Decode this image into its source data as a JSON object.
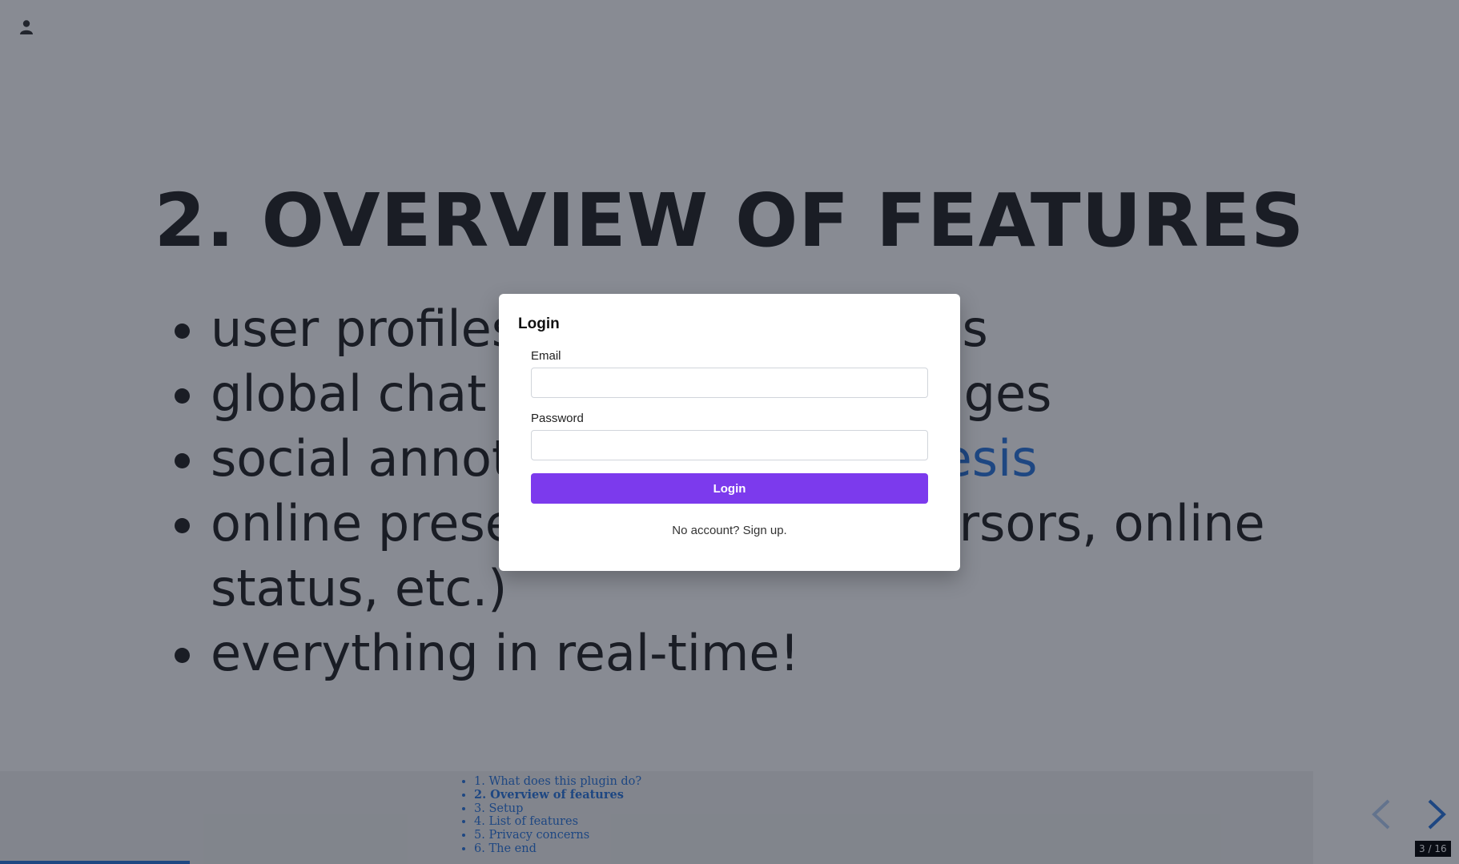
{
  "slide": {
    "title": "2. Overview of features",
    "bullets": [
      {
        "text": "user profiles and private rooms"
      },
      {
        "text": "global chat and private messages"
      },
      {
        "text": "social annotations via ",
        "link": "hypothesis"
      },
      {
        "text": "online presence indicators (cursors, online status, etc.)"
      },
      {
        "text": "everything in real-time!"
      }
    ]
  },
  "toc": [
    "1. What does this plugin do?",
    "2. Overview of features",
    "3. Setup",
    "4. List of features",
    "5. Privacy concerns",
    "6. The end"
  ],
  "toc_current_index": 1,
  "navigation": {
    "counter_current": "3",
    "counter_separator": "/",
    "counter_total": "16",
    "progress": 0.13
  },
  "login_modal": {
    "title": "Login",
    "email_label": "Email",
    "email_value": "",
    "password_label": "Password",
    "password_value": "",
    "button_label": "Login",
    "signup_text": "No account? Sign up."
  },
  "colors": {
    "accent": "#7c3aed",
    "link": "#2a76dd",
    "overlay": "rgba(17,24,39,0.5)"
  },
  "icons": {
    "user": "user-icon",
    "prev": "chevron-left-icon",
    "next": "chevron-right-icon"
  }
}
